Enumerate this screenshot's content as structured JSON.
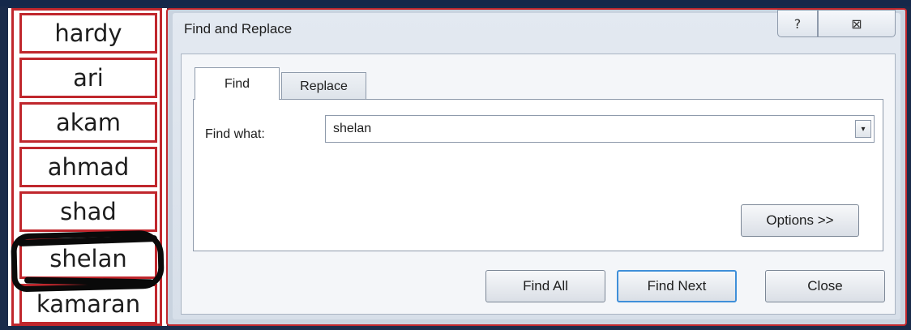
{
  "sheet": {
    "cells": [
      "hardy",
      "ari",
      "akam",
      "ahmad",
      "shad",
      "shelan",
      "kamaran"
    ],
    "highlight_color": "#c0272d",
    "redaction_color": "#0a0a0a"
  },
  "dialog": {
    "title": "Find and Replace",
    "help_icon": "?",
    "close_icon": "⊠",
    "tabs": [
      {
        "label": "Find",
        "active": true
      },
      {
        "label": "Replace",
        "active": false
      }
    ],
    "find_what": {
      "label": "Find what:",
      "value": "shelan",
      "dropdown_icon": "▾"
    },
    "buttons": {
      "options": "Options >>",
      "find_all": "Find All",
      "find_next": "Find Next",
      "close": "Close"
    }
  }
}
